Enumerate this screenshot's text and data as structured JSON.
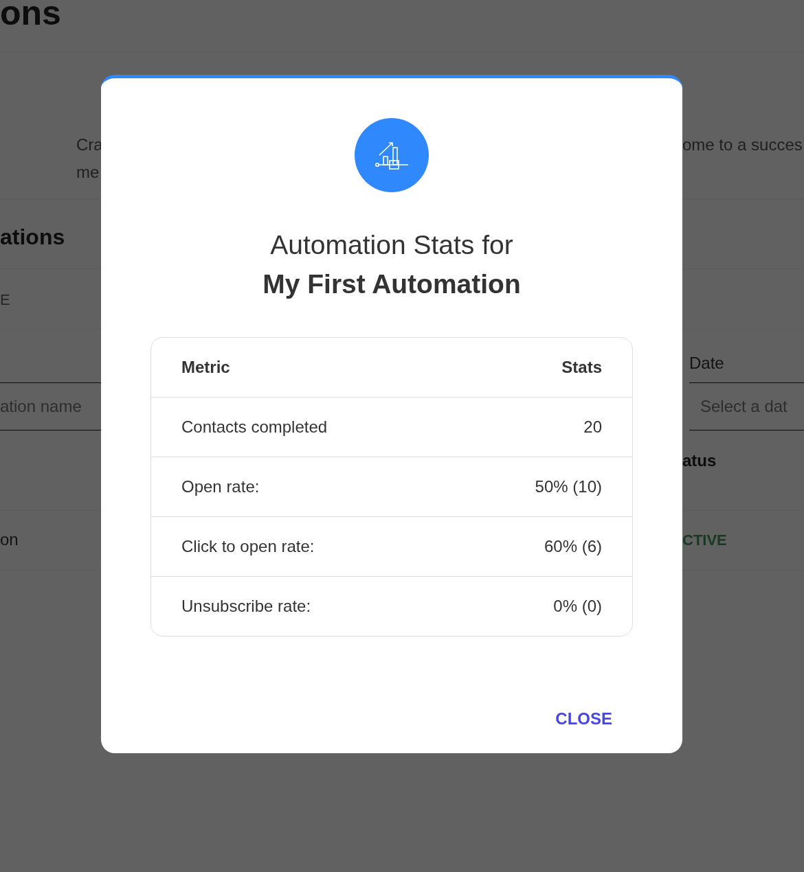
{
  "background": {
    "heading": "ons",
    "intro_left": [
      "Cra",
      "me"
    ],
    "intro_right": "ome to a succes",
    "section_title": "ations",
    "tab": "E",
    "filters": {
      "name_placeholder": "ation name",
      "date_label": "Date",
      "date_placeholder": "Select a dat"
    },
    "table": {
      "column": "atus",
      "row": {
        "name": "on",
        "status": "CTIVE"
      }
    }
  },
  "dialog": {
    "title": "Automation Stats for",
    "subtitle": "My First Automation",
    "columns": [
      "Metric",
      "Stats"
    ],
    "rows": [
      {
        "metric": "Contacts completed",
        "value": "20"
      },
      {
        "metric": "Open rate:",
        "value": "50% (10)"
      },
      {
        "metric": "Click to open rate:",
        "value": "60% (6)"
      },
      {
        "metric": "Unsubscribe rate:",
        "value": "0% (0)"
      }
    ],
    "buttons": [
      "CLOSE"
    ]
  }
}
